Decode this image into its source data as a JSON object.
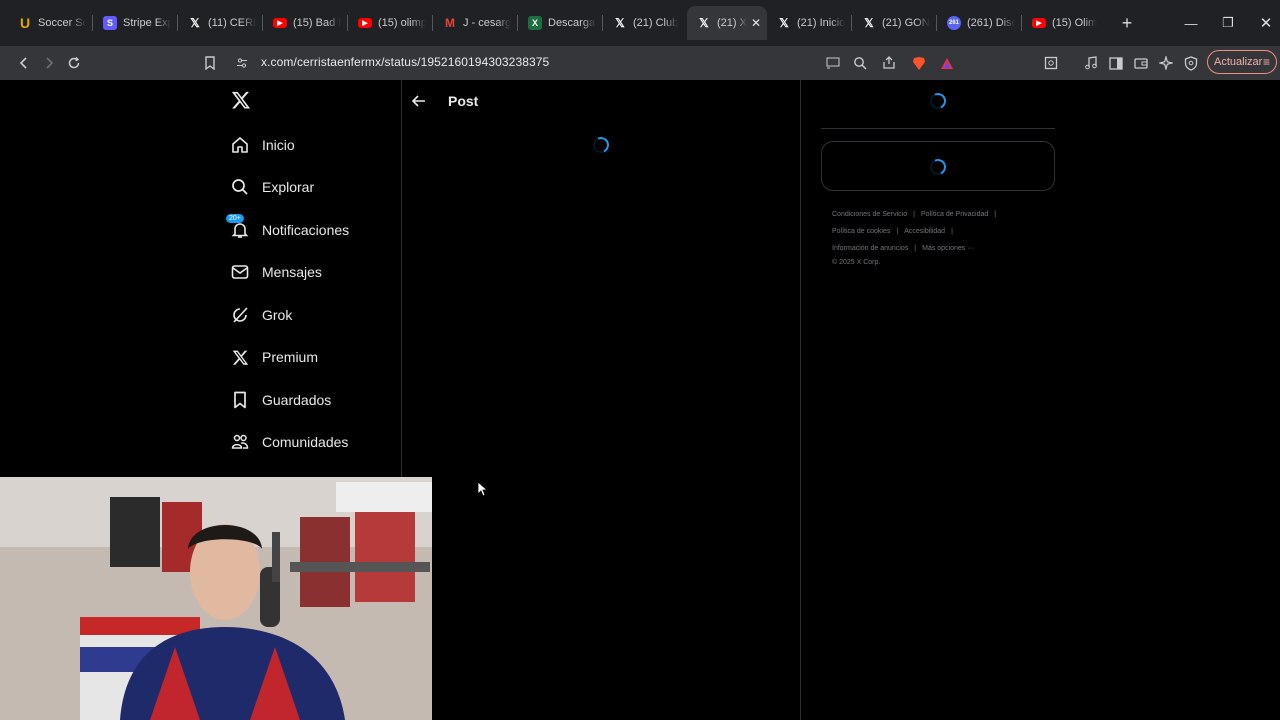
{
  "tabs": [
    {
      "title": "Soccer Sc",
      "icon": "u-icon",
      "icon_color": "#e5a50a"
    },
    {
      "title": "Stripe Exp",
      "icon": "s-icon",
      "icon_color": "#635bff"
    },
    {
      "title": "(11) CERR",
      "icon": "x-icon",
      "icon_color": "#000000"
    },
    {
      "title": "(15) Bad B",
      "icon": "youtube-icon",
      "icon_color": "#ff0000"
    },
    {
      "title": "(15) olimp",
      "icon": "youtube-icon",
      "icon_color": "#ff0000"
    },
    {
      "title": "J - cesarg",
      "icon": "gmail-icon",
      "icon_color": "#ea4335"
    },
    {
      "title": "Descargar",
      "icon": "excel-icon",
      "icon_color": "#1d6f42"
    },
    {
      "title": "(21) Club",
      "icon": "x-icon",
      "icon_color": "#000000"
    },
    {
      "title": "(21) X",
      "icon": "x-icon",
      "icon_color": "#000000",
      "active": true
    },
    {
      "title": "(21) Inicio",
      "icon": "x-icon",
      "icon_color": "#000000"
    },
    {
      "title": "(21) GON",
      "icon": "x-icon",
      "icon_color": "#000000"
    },
    {
      "title": "(261) Disc",
      "icon": "discord-icon",
      "icon_color": "#5865f2",
      "badge": "261"
    },
    {
      "title": "(15) Olim",
      "icon": "youtube-icon",
      "icon_color": "#ff0000"
    }
  ],
  "toolbar": {
    "url": "x.com/cerristaenfermx/status/1952160194303238375",
    "update_label": "Actualizar"
  },
  "nav": {
    "items": [
      {
        "label": "Inicio",
        "icon": "home-icon"
      },
      {
        "label": "Explorar",
        "icon": "search-icon"
      },
      {
        "label": "Notificaciones",
        "icon": "bell-icon",
        "badge": "20+"
      },
      {
        "label": "Mensajes",
        "icon": "mail-icon"
      },
      {
        "label": "Grok",
        "icon": "grok-icon"
      },
      {
        "label": "Premium",
        "icon": "x-icon"
      },
      {
        "label": "Guardados",
        "icon": "bookmark-icon"
      },
      {
        "label": "Comunidades",
        "icon": "people-icon"
      }
    ]
  },
  "main": {
    "title": "Post"
  },
  "footer": {
    "links": [
      "Condiciones de Servicio",
      "Política de Privacidad",
      "Política de cookies",
      "Accesibilidad",
      "Información de anuncios",
      "Más opciones ···"
    ],
    "copyright": "© 2025 X Corp."
  },
  "colors": {
    "accent": "#1d9bf0",
    "background": "#000000",
    "border": "#2f3336"
  }
}
